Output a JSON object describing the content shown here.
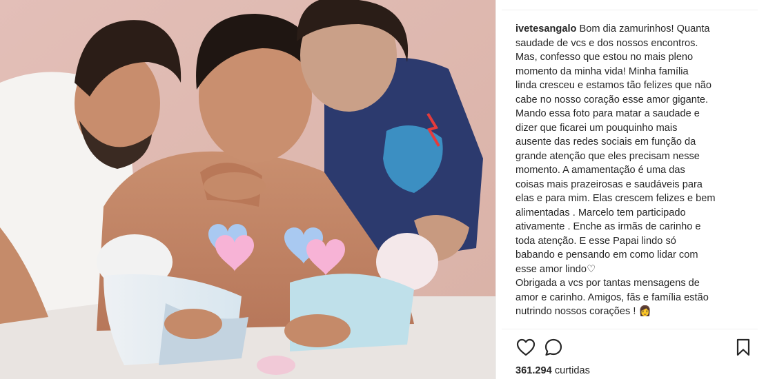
{
  "post": {
    "username": "ivetesangalo",
    "caption_lines": [
      "Bom dia zamurinhos! Quanta",
      "saudade de vcs e dos nossos encontros.",
      "Mas, confesso que estou no mais pleno",
      "momento da minha vida! Minha família",
      "linda cresceu e estamos tão felizes que não",
      "cabe no nosso coração esse amor gigante.",
      "Mando essa foto para matar a saudade e",
      "dizer que ficarei um pouquinho mais",
      "ausente das redes sociais em função da",
      "grande atenção que eles precisam nesse",
      "momento. A amamentação é uma das",
      "coisas mais prazeirosas e saudáveis para",
      "elas e para mim. Elas crescem felizes e bem",
      "alimentadas . Marcelo tem participado",
      "ativamente . Enche as irmãs de carinho e",
      "toda atenção. E esse Papai lindo só",
      "babando e pensando em como lidar com",
      "esse amor lindo♡",
      "Obrigada a vcs por tantas mensagens de",
      "amor e carinho. Amigos, fãs e família estão",
      "nutrindo nossos corações ! 👩"
    ],
    "likes_count": "361.294",
    "likes_label": "curtidas"
  },
  "icons": {
    "like": "heart-outline-icon",
    "comment": "comment-bubble-icon",
    "save": "bookmark-icon"
  },
  "colors": {
    "text": "#262626",
    "divider": "#efefef",
    "heart_pink": "#f7b3d6",
    "heart_blue": "#a9c9f1"
  }
}
